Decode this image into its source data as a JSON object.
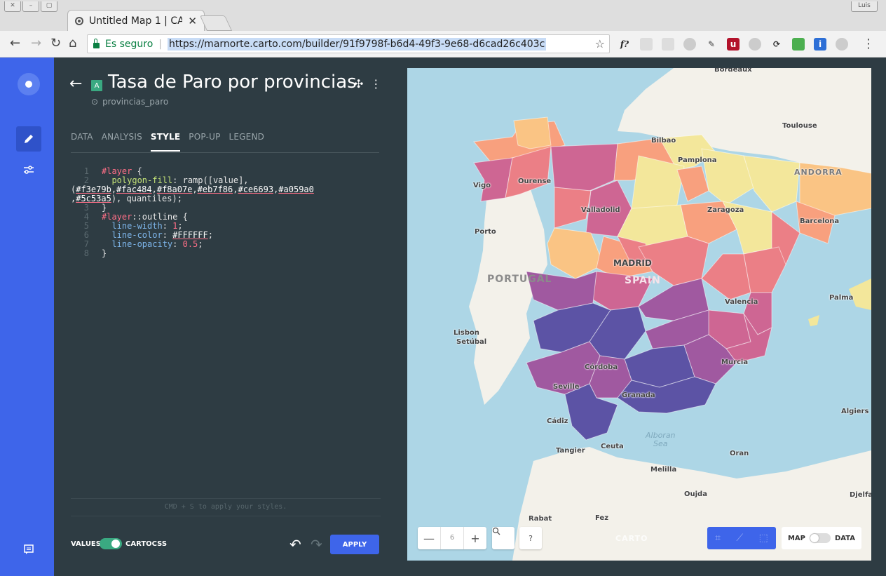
{
  "browser": {
    "tab_title": "Untitled Map 1 | CA",
    "secure_label": "Es seguro",
    "url": "https://marnorte.carto.com/builder/91f9798f-b6d4-49f3-9e68-d6cad26c403c",
    "user_label": "Luis"
  },
  "layer": {
    "badge": "A",
    "title": "Tasa de Paro por provincias",
    "source": "provincias_paro"
  },
  "tabs": [
    {
      "label": "DATA"
    },
    {
      "label": "ANALYSIS"
    },
    {
      "label": "STYLE"
    },
    {
      "label": "POP-UP"
    },
    {
      "label": "LEGEND"
    }
  ],
  "editor": {
    "hint": "CMD + S to apply your styles.",
    "lines": [
      "1",
      "2",
      "3",
      "4",
      "5",
      "6",
      "7",
      "8"
    ],
    "colors": [
      "#f3e79b",
      "#fac484",
      "#f8a07e",
      "#eb7f86",
      "#ce6693",
      "#a059a0",
      "#5c53a5"
    ]
  },
  "footer": {
    "values_label": "VALUES",
    "cartocss_label": "CARTOCSS",
    "apply_label": "APPLY"
  },
  "map": {
    "zoom_level": "6",
    "search_icon": "search-icon",
    "help_label": "?",
    "watermark": "CARTO",
    "map_label": "MAP",
    "data_label": "DATA",
    "countries": {
      "portugal": "PORTUGAL",
      "spain": "SPAIN"
    },
    "water": {
      "alboran_1": "Alboran",
      "alboran_2": "Sea"
    },
    "cities": {
      "bordeaux": "Bordeaux",
      "toulouse": "Toulouse",
      "bilbao": "Bilbao",
      "pamplona": "Pamplona",
      "andorra": "ANDORRA",
      "vigo": "Vigo",
      "ourense": "Ourense",
      "valladolid": "Valladolid",
      "zaragoza": "Zaragoza",
      "barcelona": "Barcelona",
      "porto": "Porto",
      "madrid": "MADRID",
      "palma": "Palma",
      "valencia": "Valencia",
      "lisbon": "Lisbon",
      "setubal": "Setúbal",
      "cordoba": "Córdoba",
      "murcia": "Murcia",
      "seville": "Seville",
      "granada": "Granada",
      "cadiz": "Cádiz",
      "algiers": "Algiers",
      "tangier": "Tangier",
      "ceuta": "Ceuta",
      "oran": "Oran",
      "melilla": "Melilla",
      "oujda": "Oujda",
      "djelfa": "Djelfa",
      "rabat": "Rabat",
      "fez": "Fez"
    }
  }
}
